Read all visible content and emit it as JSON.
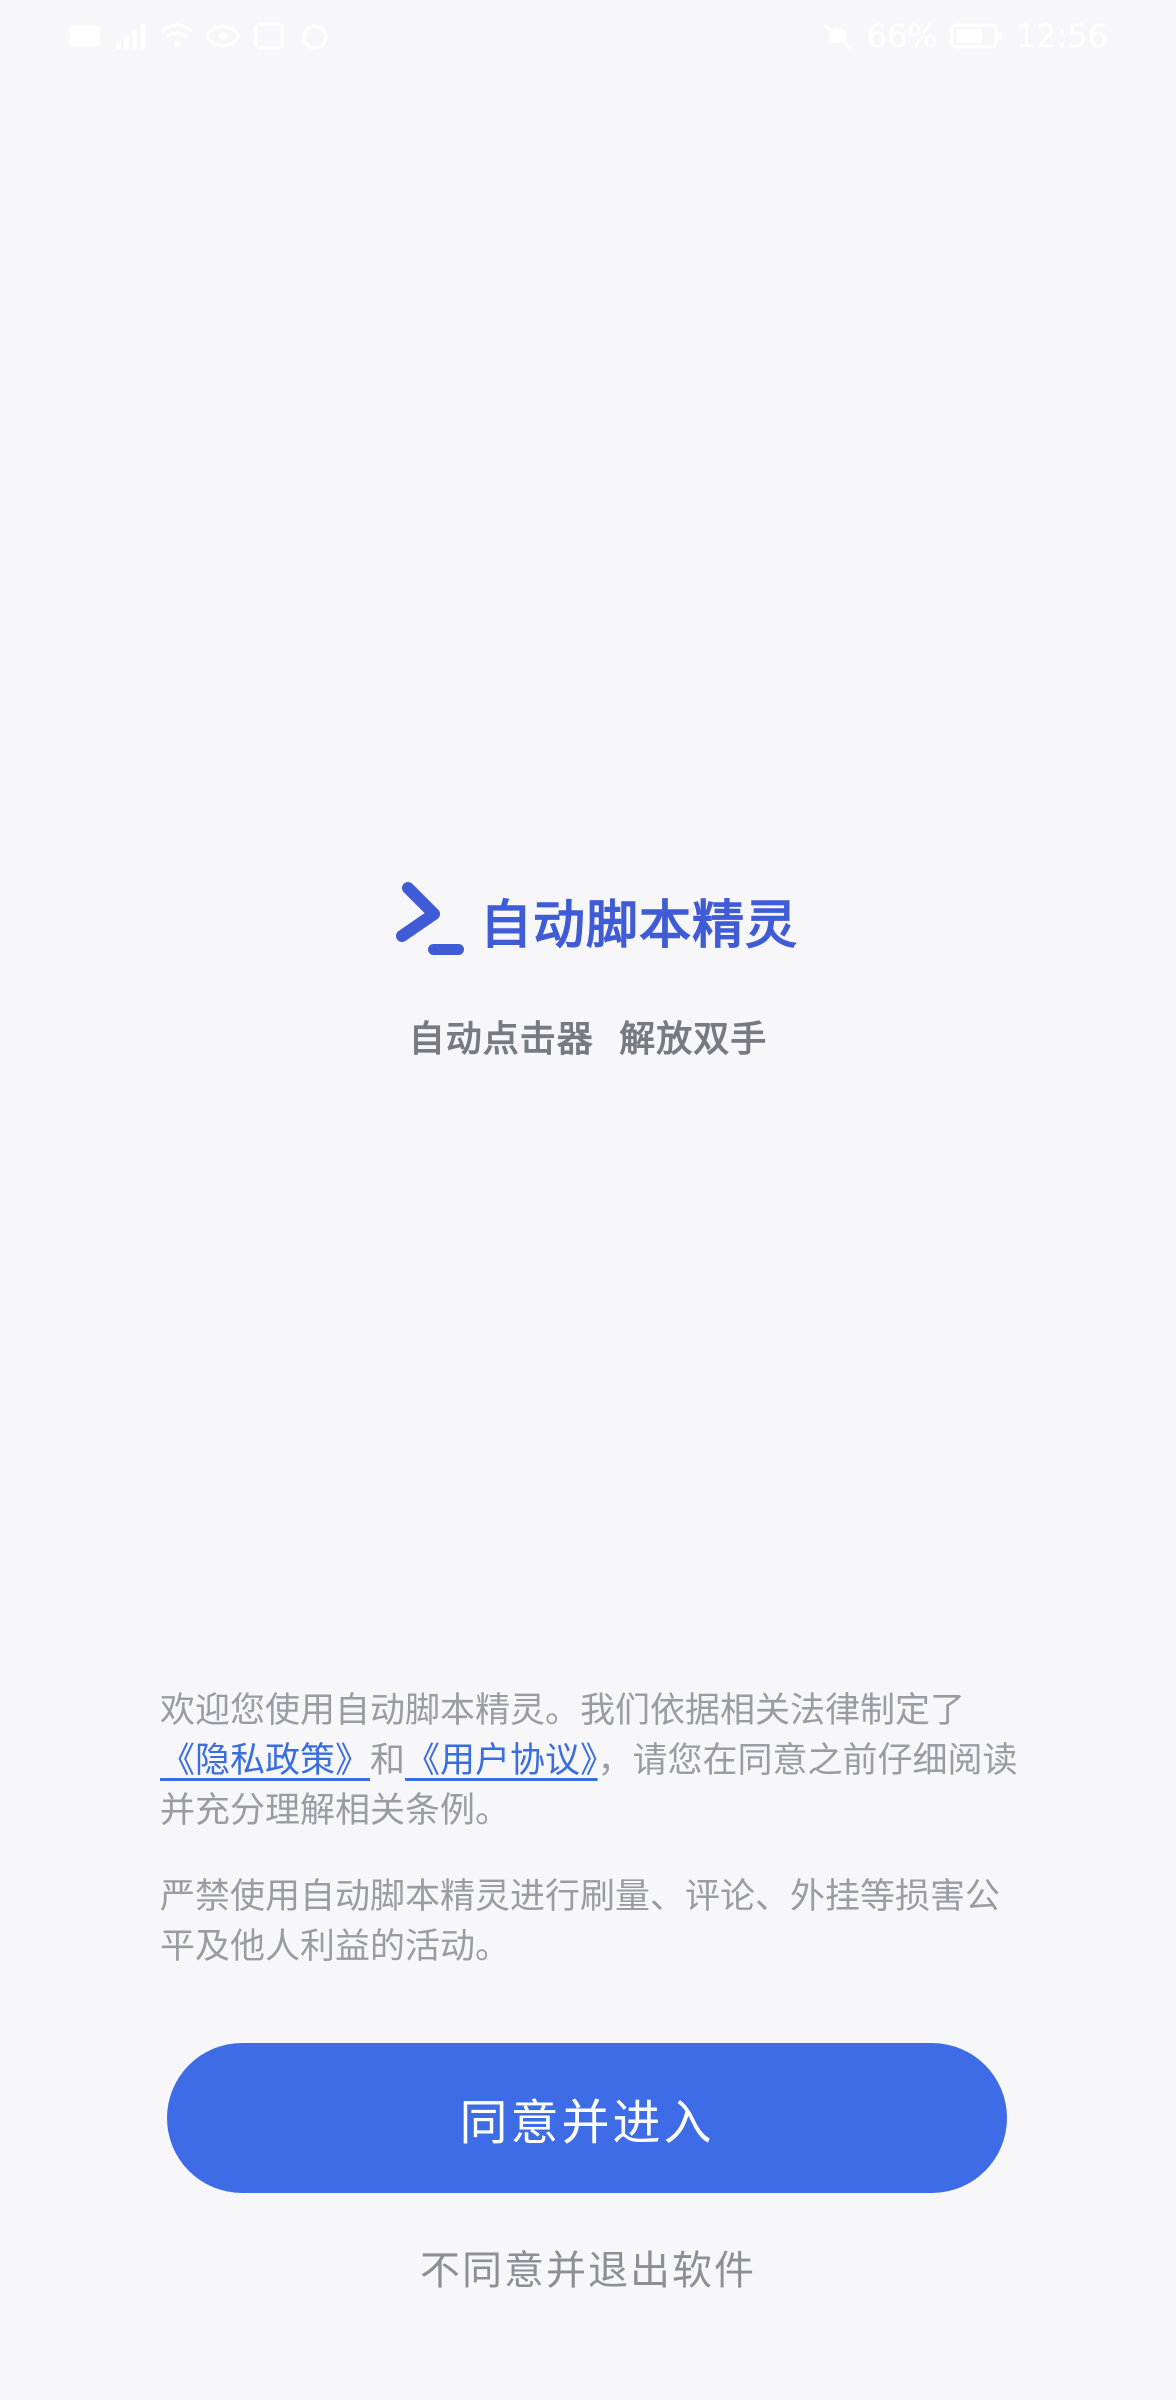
{
  "status_bar": {
    "battery": "66%",
    "time": "12:56"
  },
  "app": {
    "title": "自动脚本精灵",
    "subtitle": "自动点击器 解放双手"
  },
  "agreement": {
    "p1_prefix": "欢迎您使用自动脚本精灵。我们依据相关法律制定了",
    "privacy_link": "《隐私政策》",
    "and": "和",
    "user_link": "《用户协议》",
    "p1_suffix": "，请您在同意之前仔细阅读并充分理解相关条例。",
    "p2": "严禁使用自动脚本精灵进行刷量、评论、外挂等损害公平及他人利益的活动。"
  },
  "buttons": {
    "agree": "同意并进入",
    "exit": "不同意并退出软件"
  },
  "colors": {
    "accent": "#3d6ce6",
    "brand": "#3f5bd6",
    "background": "#f7f7f9"
  }
}
